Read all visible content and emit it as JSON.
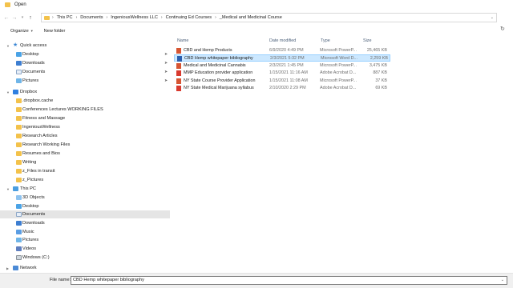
{
  "window": {
    "title": "Open"
  },
  "address": {
    "crumbs": [
      "This PC",
      "Documents",
      "IngeniousWellness LLC",
      "Continuing Ed Courses",
      "_Medical and Medicinal Course"
    ]
  },
  "toolbar": {
    "organize": "Organize",
    "new_folder": "New folder"
  },
  "nav": {
    "quick_access": "Quick access",
    "quick_items": [
      "Desktop",
      "Downloads",
      "Documents",
      "Pictures"
    ],
    "dropbox": "Dropbox",
    "dropbox_items": [
      ".dropbox.cache",
      "Conferences Lectures WORKING FILES",
      "Fitness and Massage",
      "IngeniousWellness",
      "Research Articles",
      "Research Working Files",
      "Resumes and Bios",
      "Writing",
      "z_Files in transit",
      "z_Pictures"
    ],
    "this_pc": "This PC",
    "pc_items": [
      "3D Objects",
      "Desktop",
      "Documents",
      "Downloads",
      "Music",
      "Pictures",
      "Videos",
      "Windows (C:)"
    ],
    "network": "Network"
  },
  "columns": {
    "name": "Name",
    "date": "Date modified",
    "type": "Type",
    "size": "Size"
  },
  "files": [
    {
      "name": "CBD and Hemp Products",
      "date": "6/9/2020 4:49 PM",
      "type": "Microsoft PowerP...",
      "size": "25,465 KB",
      "kind": "ppt"
    },
    {
      "name": "CBD Hemp whitepaper bibliography",
      "date": "2/3/2021 5:32 PM",
      "type": "Microsoft Word D...",
      "size": "2,259 KB",
      "kind": "word"
    },
    {
      "name": "Medical and Medicinal Cannabis",
      "date": "2/3/2021 1:45 PM",
      "type": "Microsoft PowerP...",
      "size": "3,475 KB",
      "kind": "ppt"
    },
    {
      "name": "MMP Education provider application",
      "date": "1/15/2021 11:16 AM",
      "type": "Adobe Acrobat D...",
      "size": "887 KB",
      "kind": "pdf"
    },
    {
      "name": "NY State Course Provider Application",
      "date": "1/15/2021 11:08 AM",
      "type": "Microsoft PowerP...",
      "size": "37 KB",
      "kind": "ppt"
    },
    {
      "name": "NY State Medical Marijuana syllabus",
      "date": "2/10/2020 2:29 PM",
      "type": "Adobe Acrobat D...",
      "size": "69 KB",
      "kind": "pdf"
    }
  ],
  "footer": {
    "file_name_label": "File name:",
    "file_name_value": "CBD Hemp whitepaper bibliography"
  }
}
